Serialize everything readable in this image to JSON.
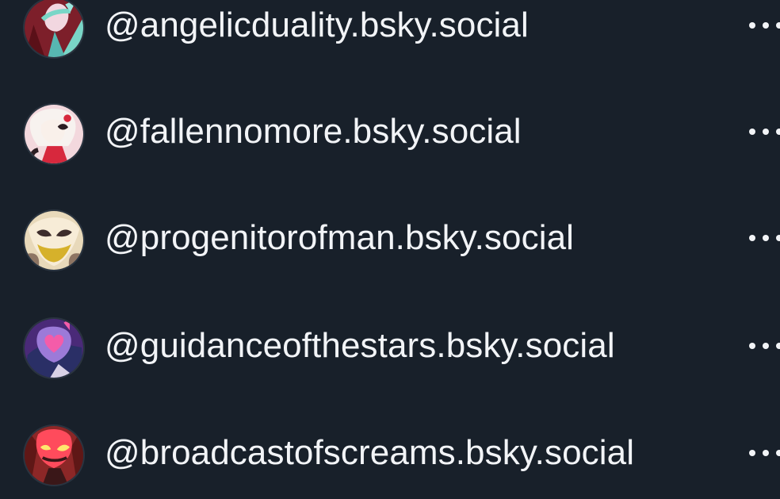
{
  "accounts": [
    {
      "handle": "@angelicduality.bsky.social",
      "avatar_icon": "avatar-icon",
      "more_icon": "more-horizontal-icon",
      "avatar_colors": {
        "bg": "#7d1f2a",
        "accent": "#79d6c7",
        "skin": "#f2d7e0"
      }
    },
    {
      "handle": "@fallennomore.bsky.social",
      "avatar_icon": "avatar-icon",
      "more_icon": "more-horizontal-icon",
      "avatar_colors": {
        "bg": "#f3d8dd",
        "accent": "#d7283d",
        "skin": "#f9f0ea"
      }
    },
    {
      "handle": "@progenitorofman.bsky.social",
      "avatar_icon": "avatar-icon",
      "more_icon": "more-horizontal-icon",
      "avatar_colors": {
        "bg": "#e8d9ba",
        "accent": "#d6b12b",
        "skin": "#3d2d2c"
      }
    },
    {
      "handle": "@guidanceofthestars.bsky.social",
      "avatar_icon": "avatar-icon",
      "more_icon": "more-horizontal-icon",
      "avatar_colors": {
        "bg": "#4a2a78",
        "accent": "#f45ca9",
        "skin": "#9c7ad8"
      }
    },
    {
      "handle": "@broadcastofscreams.bsky.social",
      "avatar_icon": "avatar-icon",
      "more_icon": "more-horizontal-icon",
      "avatar_colors": {
        "bg": "#8c2727",
        "accent": "#ff4b5c",
        "skin": "#3a1718"
      }
    }
  ],
  "theme": {
    "background": "#18202a",
    "text": "#f2f4f7"
  }
}
